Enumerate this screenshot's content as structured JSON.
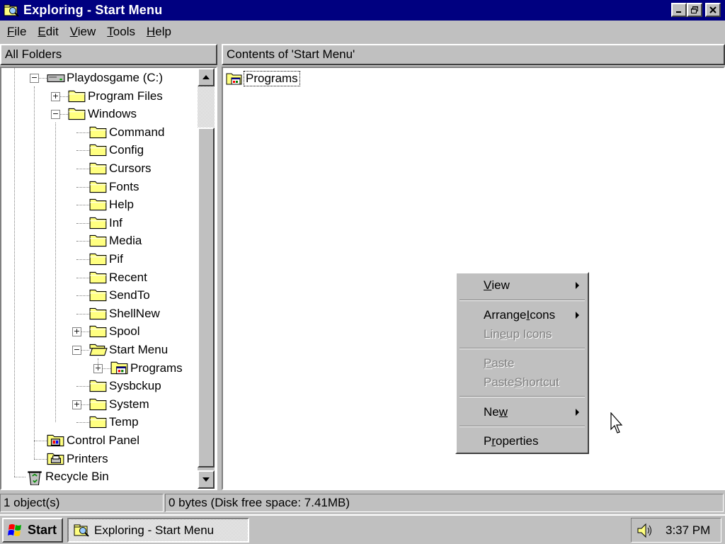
{
  "window": {
    "title": "Exploring - Start Menu",
    "controls": [
      "minimize",
      "restore",
      "close"
    ]
  },
  "menubar": {
    "items": [
      {
        "label": "File",
        "accel": "F",
        "rest": "ile"
      },
      {
        "label": "Edit",
        "accel": "E",
        "rest": "dit"
      },
      {
        "label": "View",
        "accel": "V",
        "rest": "iew"
      },
      {
        "label": "Tools",
        "accel": "T",
        "rest": "ools"
      },
      {
        "label": "Help",
        "accel": "H",
        "rest": "elp"
      }
    ]
  },
  "panes": {
    "left_header": "All Folders",
    "right_header": "Contents of 'Start Menu'"
  },
  "tree": {
    "items": [
      {
        "label": "Playdosgame (C:)",
        "icon": "drive-icon",
        "expander": "minus"
      },
      {
        "label": "Program Files",
        "icon": "folder-icon",
        "expander": "plus"
      },
      {
        "label": "Windows",
        "icon": "folder-icon",
        "expander": "minus"
      },
      {
        "label": "Command",
        "icon": "folder-icon",
        "expander": "none"
      },
      {
        "label": "Config",
        "icon": "folder-icon",
        "expander": "none"
      },
      {
        "label": "Cursors",
        "icon": "folder-icon",
        "expander": "none"
      },
      {
        "label": "Fonts",
        "icon": "folder-icon",
        "expander": "none"
      },
      {
        "label": "Help",
        "icon": "folder-icon",
        "expander": "none"
      },
      {
        "label": "Inf",
        "icon": "folder-icon",
        "expander": "none"
      },
      {
        "label": "Media",
        "icon": "folder-icon",
        "expander": "none"
      },
      {
        "label": "Pif",
        "icon": "folder-icon",
        "expander": "none"
      },
      {
        "label": "Recent",
        "icon": "folder-icon",
        "expander": "none"
      },
      {
        "label": "SendTo",
        "icon": "folder-icon",
        "expander": "none"
      },
      {
        "label": "ShellNew",
        "icon": "folder-icon",
        "expander": "none"
      },
      {
        "label": "Spool",
        "icon": "folder-icon",
        "expander": "plus"
      },
      {
        "label": "Start Menu",
        "icon": "open-folder-icon",
        "expander": "minus"
      },
      {
        "label": "Programs",
        "icon": "program-group-icon",
        "expander": "plus"
      },
      {
        "label": "Sysbckup",
        "icon": "folder-icon",
        "expander": "none"
      },
      {
        "label": "System",
        "icon": "folder-icon",
        "expander": "plus"
      },
      {
        "label": "Temp",
        "icon": "folder-icon",
        "expander": "none"
      },
      {
        "label": "Control Panel",
        "icon": "control-panel-icon",
        "expander": "none"
      },
      {
        "label": "Printers",
        "icon": "printers-icon",
        "expander": "none"
      },
      {
        "label": "Recycle Bin",
        "icon": "recycle-bin-icon",
        "expander": "none"
      }
    ]
  },
  "content": {
    "items": [
      {
        "label": "Programs",
        "icon": "program-group-icon"
      }
    ]
  },
  "context_menu": {
    "items": [
      {
        "label": "View",
        "accel": "V",
        "pre": "",
        "post": "iew",
        "enabled": true,
        "submenu": true
      },
      {
        "label": "Arrange Icons",
        "accel": "I",
        "pre": "Arrange ",
        "post": "cons",
        "enabled": true,
        "submenu": true
      },
      {
        "label": "Line up Icons",
        "accel": "e",
        "pre": "Lin",
        "post": " up Icons",
        "enabled": false,
        "submenu": false
      },
      {
        "label": "Paste",
        "accel": "P",
        "pre": "",
        "post": "aste",
        "enabled": false,
        "submenu": false
      },
      {
        "label": "Paste Shortcut",
        "accel": "S",
        "pre": "Paste ",
        "post": "hortcut",
        "enabled": false,
        "submenu": false
      },
      {
        "label": "New",
        "accel": "w",
        "pre": "Ne",
        "post": "",
        "enabled": true,
        "submenu": true
      },
      {
        "label": "Properties",
        "accel": "r",
        "pre": "P",
        "post": "operties",
        "enabled": true,
        "submenu": false
      }
    ]
  },
  "statusbar": {
    "objects": "1 object(s)",
    "info": "0 bytes (Disk free space: 7.41MB)"
  },
  "taskbar": {
    "start_label": "Start",
    "task_label": "Exploring - Start Menu",
    "clock": "3:37 PM",
    "tray_icon": "speaker-icon"
  },
  "colors": {
    "title_bar": "#000080",
    "face": "#c0c0c0",
    "folder": "#ffff80",
    "window_bg": "#ffffff"
  }
}
